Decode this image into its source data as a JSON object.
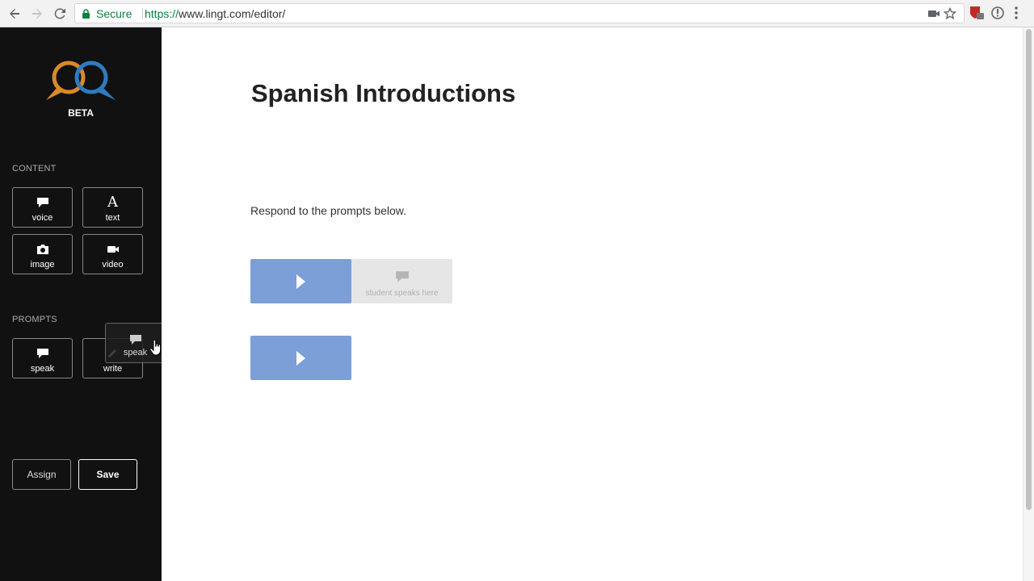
{
  "browser": {
    "secure_label": "Secure",
    "url_protocol": "https://",
    "url_rest": "www.lingt.com/editor/"
  },
  "sidebar": {
    "beta_label": "BETA",
    "content_label": "CONTENT",
    "content_items": [
      {
        "label": "voice",
        "icon": "speech-bubble-icon"
      },
      {
        "label": "text",
        "icon": "letter-a-icon"
      },
      {
        "label": "image",
        "icon": "camera-icon"
      },
      {
        "label": "video",
        "icon": "video-camera-icon"
      }
    ],
    "prompts_label": "PROMPTS",
    "prompt_items": [
      {
        "label": "speak",
        "icon": "speech-bubble-icon"
      },
      {
        "label": "write",
        "icon": "pencil-icon"
      }
    ],
    "assign_label": "Assign",
    "save_label": "Save",
    "drag_ghost_label": "speak"
  },
  "main": {
    "title": "Spanish Introductions",
    "instructions": "Respond to the prompts below.",
    "response_placeholder": "student speaks here"
  },
  "colors": {
    "sidebar_bg": "#111111",
    "play_block": "#7b9fd6",
    "response_block": "#e6e6e6",
    "logo_orange": "#d98a2b",
    "logo_blue": "#2e7bbf",
    "secure_green": "#0b8043"
  }
}
